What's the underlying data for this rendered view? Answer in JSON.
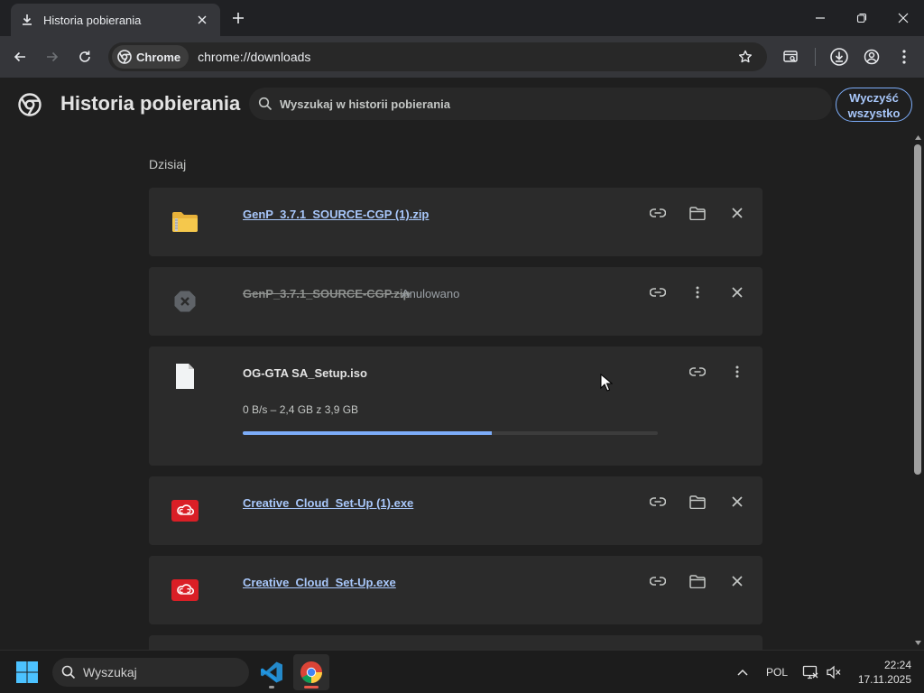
{
  "browser": {
    "tab": {
      "title": "Historia pobierania"
    },
    "chip_label": "Chrome",
    "url": "chrome://downloads"
  },
  "page": {
    "title": "Historia pobierania",
    "search_placeholder": "Wyszukaj w historii pobierania",
    "clear_all": {
      "line1": "Wyczyść",
      "line2": "wszystko"
    },
    "section_label": "Dzisiaj"
  },
  "downloads": [
    {
      "name": "GenP_3.7.1_SOURCE-CGP (1).zip",
      "state": "complete",
      "icon": "zip-folder-icon"
    },
    {
      "name": "GenP_3.7.1_SOURCE-CGP.zip",
      "state": "cancelled",
      "status": "Anulowano",
      "icon": "cancelled-icon"
    },
    {
      "name": "OG-GTA SA_Setup.iso",
      "state": "in-progress",
      "progress_text": "0 B/s – 2,4 GB z 3,9 GB",
      "progress": 0.6,
      "icon": "file-icon"
    },
    {
      "name": "Creative_Cloud_Set-Up (1).exe",
      "state": "complete",
      "icon": "creative-cloud-icon"
    },
    {
      "name": "Creative_Cloud_Set-Up.exe",
      "state": "complete",
      "icon": "creative-cloud-icon"
    }
  ],
  "taskbar": {
    "search_placeholder": "Wyszukaj",
    "language": "POL",
    "time": "22:24",
    "date": "17.11.2025"
  },
  "colors": {
    "accent": "#a8c7fa",
    "progress": "#7cacf8",
    "background": "#1f1f1f",
    "card": "#2b2b2b"
  }
}
